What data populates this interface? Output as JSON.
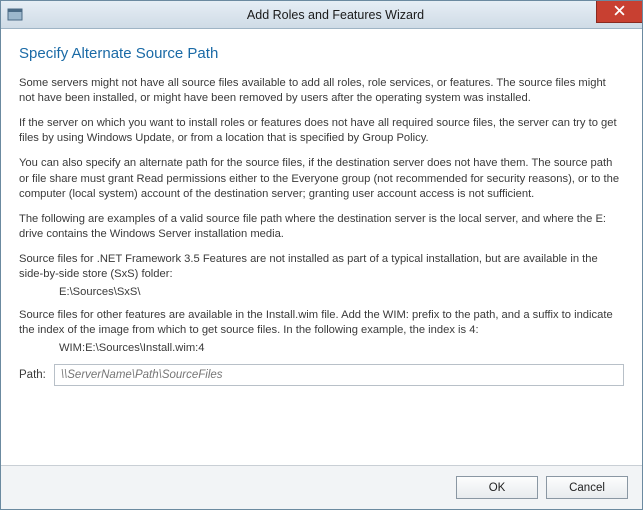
{
  "window": {
    "title": "Add Roles and Features Wizard"
  },
  "heading": "Specify Alternate Source Path",
  "paragraphs": {
    "p1": "Some servers might not have all source files available to add all roles, role services, or features. The source files might not have been installed, or might have been removed by users after the operating system was installed.",
    "p2": "If the server on which you want to install roles or features does not have all required source files, the server can try to get files by using Windows Update, or from a location that is specified by Group Policy.",
    "p3": "You can also specify an alternate path for the source files, if the destination server does not have them. The source path or file share must grant Read permissions either to the Everyone group (not recommended for security reasons), or to the computer (local system) account of the destination server; granting user account access is not sufficient.",
    "p4": "The following are examples of a valid source file path where the destination server is the local server, and where the E: drive contains the Windows Server installation media.",
    "p5": "Source files for .NET Framework 3.5 Features are not installed as part of a typical installation, but are available in the side-by-side store (SxS) folder:",
    "p5_example": "E:\\Sources\\SxS\\",
    "p6": "Source files for other features are available in the Install.wim file. Add the WIM: prefix to the path, and a suffix to indicate the index of the image from which to get source files. In the following example, the index is 4:",
    "p6_example": "WIM:E:\\Sources\\Install.wim:4"
  },
  "path": {
    "label": "Path:",
    "placeholder": "\\\\ServerName\\Path\\SourceFiles",
    "value": ""
  },
  "buttons": {
    "ok": "OK",
    "cancel": "Cancel"
  }
}
